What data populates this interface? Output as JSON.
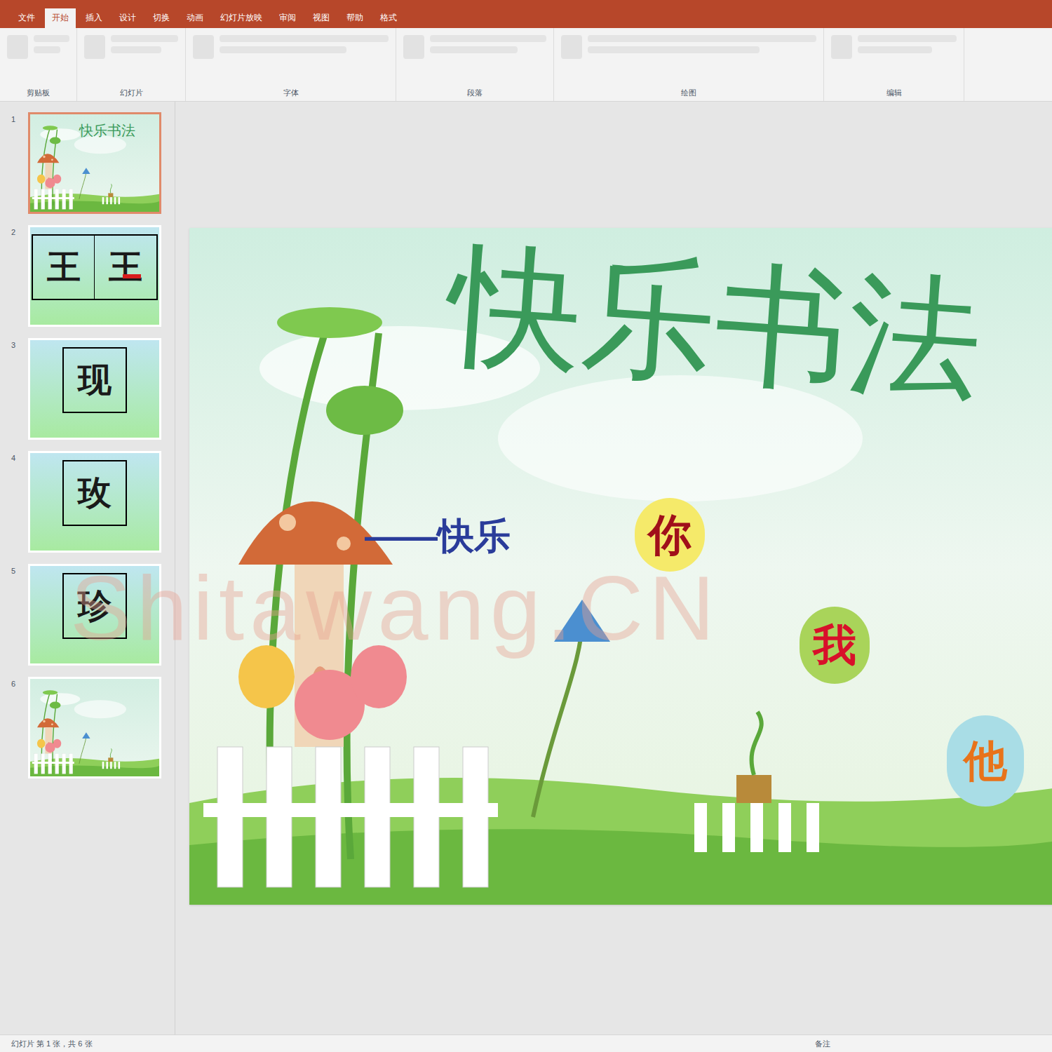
{
  "ribbon": {
    "tabs": [
      {
        "label": "文件",
        "selected": false
      },
      {
        "label": "开始",
        "selected": true
      },
      {
        "label": "插入",
        "selected": false
      },
      {
        "label": "设计",
        "selected": false
      },
      {
        "label": "切换",
        "selected": false
      },
      {
        "label": "动画",
        "selected": false
      },
      {
        "label": "幻灯片放映",
        "selected": false
      },
      {
        "label": "审阅",
        "selected": false
      },
      {
        "label": "视图",
        "selected": false
      },
      {
        "label": "帮助",
        "selected": false
      },
      {
        "label": "格式",
        "selected": false
      }
    ],
    "groups": [
      "剪贴板",
      "幻灯片",
      "字体",
      "段落",
      "绘图",
      "编辑"
    ]
  },
  "thumbnails": [
    {
      "number": "1",
      "kind": "title",
      "chars": [],
      "selected": true
    },
    {
      "number": "2",
      "kind": "chars",
      "chars": [
        "王",
        "王"
      ],
      "selected": false
    },
    {
      "number": "3",
      "kind": "chars",
      "chars": [
        "现"
      ],
      "selected": false
    },
    {
      "number": "4",
      "kind": "chars",
      "chars": [
        "玫"
      ],
      "selected": false
    },
    {
      "number": "5",
      "kind": "chars",
      "chars": [
        "珍"
      ],
      "selected": false
    },
    {
      "number": "6",
      "kind": "landscape",
      "chars": [],
      "selected": false
    }
  ],
  "slide": {
    "title": "快乐书法",
    "subtitle": "——快乐",
    "pronouns": [
      {
        "text": "你",
        "color": "#f5ea6a",
        "text_color": "#a0101a"
      },
      {
        "text": "我",
        "color": "#a9d45a",
        "text_color": "#d8102a"
      },
      {
        "text": "他",
        "color": "#a9dde6",
        "text_color": "#e8731a"
      }
    ]
  },
  "watermark": "Shitawang.CN",
  "status_bar": {
    "left": "幻灯片 第 1 张，共 6 张",
    "right": "备注"
  }
}
